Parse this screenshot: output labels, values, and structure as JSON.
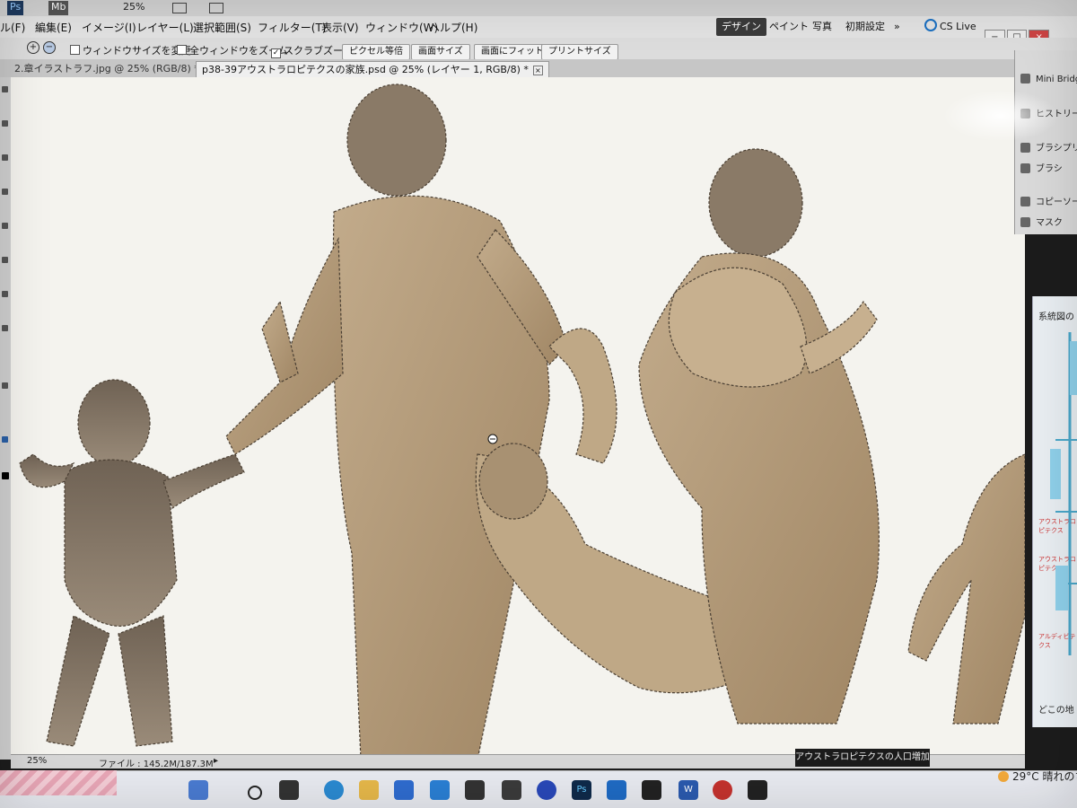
{
  "appbar": {
    "logo_ps": "Ps",
    "logo_mb": "Mb",
    "zoom": "25%"
  },
  "menu": {
    "items": [
      "ル(F)",
      "編集(E)",
      "イメージ(I)",
      "レイヤー(L)",
      "選択範囲(S)",
      "フィルター(T)",
      "表示(V)",
      "ウィンドウ(W)",
      "ヘルプ(H)"
    ],
    "workspaces": [
      "デザイン",
      "ペイント",
      "写真",
      "初期設定"
    ],
    "more": "»",
    "cs_live": "CS Live"
  },
  "options": {
    "resize_windows": "ウィンドウサイズを変更",
    "zoom_all_windows": "全ウィンドウをズーム",
    "scrubby_zoom": "スクラブズーム",
    "btn_actual_pixels": "ピクセル等倍",
    "btn_fit_screen": "画面サイズ",
    "btn_fill_screen": "画面にフィット",
    "btn_print_size": "プリントサイズ"
  },
  "tabs": [
    {
      "label": "2.章イラストラフ.jpg @ 25% (RGB/8) *"
    },
    {
      "label": "p38-39アウストラロピテクスの家族.psd @ 25% (レイヤー 1, RGB/8) *"
    }
  ],
  "panels": {
    "items": [
      "Mini Bridge",
      "ヒストリー",
      "ブラシプリセ",
      "ブラシ",
      "コピーソース",
      "マスク"
    ]
  },
  "side_doc": {
    "heading": "系統図の",
    "labels": [
      "アウストラロピテクス",
      "アウストラロピテクス",
      "アルディピテクス"
    ],
    "bottom": "どこの地"
  },
  "status": {
    "zoom": "25%",
    "file_info": "ファイル : 145.2M/187.3M"
  },
  "tooltip": "アウストラロピテクスの人口増加",
  "taskbar": {
    "weather_temp": "29°C",
    "weather_text": "晴れのち"
  },
  "colors": {
    "fur": "#b59c7c",
    "fur_dark": "#6b5a46",
    "canvas_bg": "#f4f3ee",
    "active_workspace": "#3a3a3a"
  }
}
